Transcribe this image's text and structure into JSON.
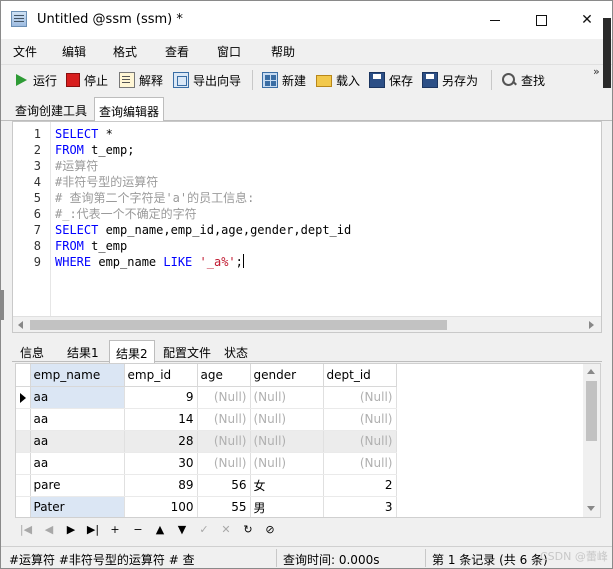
{
  "window": {
    "title": "Untitled @ssm (ssm) *",
    "controls": {
      "minimize": "—",
      "maximize": "☐",
      "close": "✕"
    }
  },
  "menu": [
    "文件",
    "编辑",
    "格式",
    "查看",
    "窗口",
    "帮助"
  ],
  "toolbar": {
    "run": "运行",
    "stop": "停止",
    "explain": "解释",
    "export_wizard": "导出向导",
    "new": "新建",
    "load": "载入",
    "save": "保存",
    "save_as": "另存为",
    "find": "查找",
    "overflow": "»",
    "icons": [
      "play-icon",
      "stop-icon",
      "explain-icon",
      "export-icon",
      "new-icon",
      "load-icon",
      "save-icon",
      "save-as-icon",
      "search-icon"
    ]
  },
  "query_tabs": [
    "查询创建工具",
    "查询编辑器"
  ],
  "editor": {
    "lines": [
      {
        "n": "1",
        "parts": [
          {
            "t": "SELECT",
            "c": "kw"
          },
          {
            "t": " *",
            "c": "pl"
          }
        ]
      },
      {
        "n": "2",
        "parts": [
          {
            "t": "FROM",
            "c": "kw"
          },
          {
            "t": " t_emp;",
            "c": "pl"
          }
        ]
      },
      {
        "n": "3",
        "parts": [
          {
            "t": "#运算符",
            "c": "cm"
          }
        ]
      },
      {
        "n": "4",
        "parts": [
          {
            "t": "#非符号型的运算符",
            "c": "cm"
          }
        ]
      },
      {
        "n": "5",
        "parts": [
          {
            "t": "# 查询第二个字符是'a'的员工信息:",
            "c": "cm"
          }
        ]
      },
      {
        "n": "6",
        "parts": [
          {
            "t": "#_:代表一个不确定的字符",
            "c": "cm"
          }
        ]
      },
      {
        "n": "7",
        "parts": [
          {
            "t": "SELECT",
            "c": "kw"
          },
          {
            "t": " emp_name,emp_id,age,gender,dept_id",
            "c": "pl"
          }
        ]
      },
      {
        "n": "8",
        "parts": [
          {
            "t": "FROM",
            "c": "kw"
          },
          {
            "t": " t_emp",
            "c": "pl"
          }
        ]
      },
      {
        "n": "9",
        "parts": [
          {
            "t": "WHERE",
            "c": "kw"
          },
          {
            "t": " emp_name ",
            "c": "pl"
          },
          {
            "t": "LIKE",
            "c": "kw"
          },
          {
            "t": " ",
            "c": "pl"
          },
          {
            "t": "'_a%'",
            "c": "st"
          },
          {
            "t": ";",
            "c": "pl"
          }
        ]
      }
    ]
  },
  "result_tabs": [
    "信息",
    "结果1",
    "结果2",
    "配置文件",
    "状态"
  ],
  "grid": {
    "columns": [
      "emp_name",
      "emp_id",
      "age",
      "gender",
      "dept_id"
    ],
    "rows": [
      [
        "aa",
        "9",
        "(Null)",
        "(Null)",
        "(Null)"
      ],
      [
        "aa",
        "14",
        "(Null)",
        "(Null)",
        "(Null)"
      ],
      [
        "aa",
        "28",
        "(Null)",
        "(Null)",
        "(Null)"
      ],
      [
        "aa",
        "30",
        "(Null)",
        "(Null)",
        "(Null)"
      ],
      [
        "pare",
        "89",
        "56",
        "女",
        "2"
      ],
      [
        "Pater",
        "100",
        "55",
        "男",
        "3"
      ]
    ]
  },
  "nav": [
    "|◀",
    "◀",
    "▶",
    "▶|",
    "+",
    "−",
    "▲",
    "▼",
    "✓",
    "✕",
    "↻",
    "⊘"
  ],
  "status": {
    "sql_preview": "#运算符 #非符号型的运算符 # 查",
    "query_time": "查询时间: 0.000s",
    "record": "第 1 条记录 (共 6 条)"
  },
  "watermark": "CSDN @蕾峰"
}
